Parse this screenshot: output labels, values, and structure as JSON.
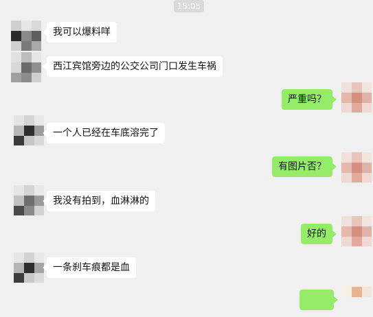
{
  "timestamp": "15:05",
  "messages": [
    {
      "side": "left",
      "text": "我可以爆料咩"
    },
    {
      "side": "left",
      "text": "西江宾馆旁边的公交公司门口发生车祸"
    },
    {
      "side": "right",
      "text": "严重吗？"
    },
    {
      "side": "left",
      "text": "一个人已经在车底溶完了"
    },
    {
      "side": "right",
      "text": "有图片否？"
    },
    {
      "side": "left",
      "text": "我没有拍到，血淋淋的"
    },
    {
      "side": "right",
      "text": "好的"
    },
    {
      "side": "left",
      "text": "一条刹车痕都是血"
    },
    {
      "side": "right",
      "text": ""
    }
  ],
  "colors": {
    "background": "#f0f0f0",
    "incoming_bubble": "#ffffff",
    "outgoing_bubble": "#95ec69"
  }
}
